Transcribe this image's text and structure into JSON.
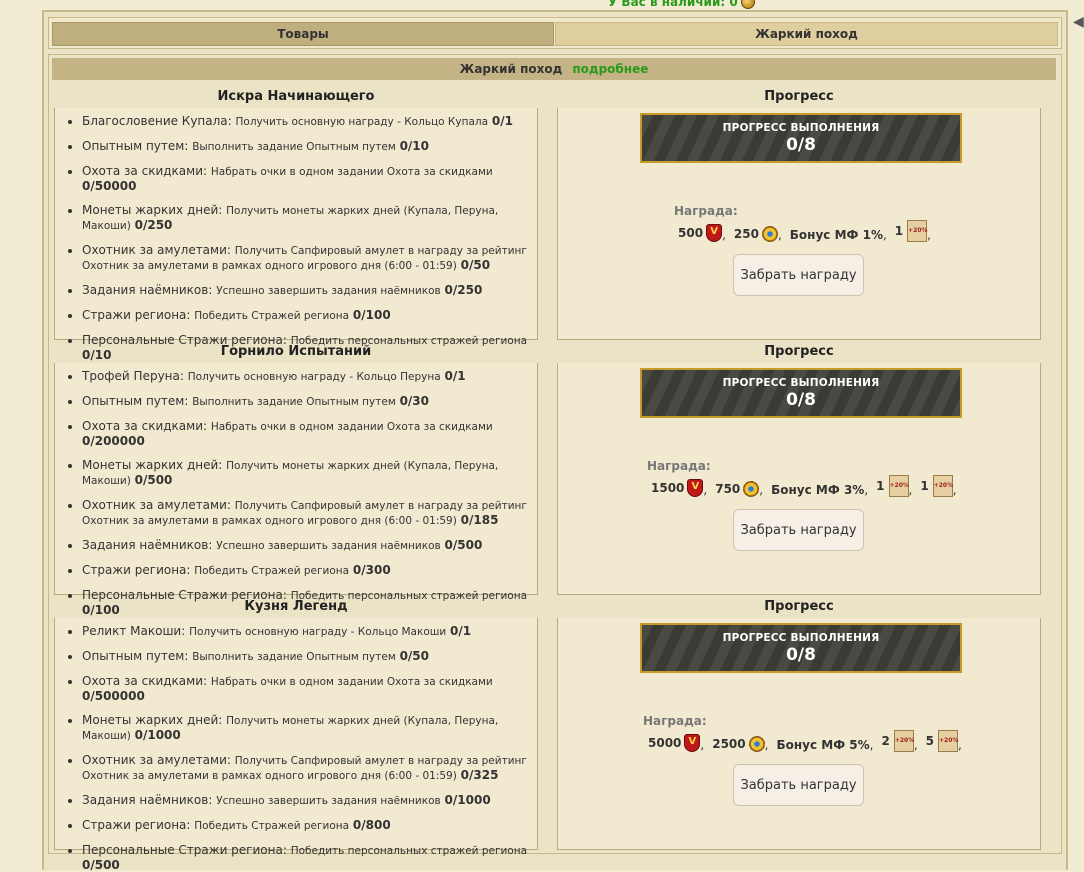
{
  "top": {
    "have_label": "У Вас в наличии: 0"
  },
  "tabs": {
    "goods": "Товары",
    "hot": "Жаркий поход"
  },
  "section": {
    "title": "Жаркий поход",
    "more": "подробнее"
  },
  "progress_title": "Прогресс",
  "progress_bar_label": "ПРОГРЕСС ВЫПОЛНЕНИЯ",
  "reward_label": "Награда:",
  "claim_label": "Забрать награду",
  "tiers": [
    {
      "title": "Искра Начинающего",
      "progress": "0/8",
      "tasks": [
        {
          "name": "Благословение Купала:",
          "desc": "Получить основную награду - Кольцо Купала",
          "val": "0/1"
        },
        {
          "name": "Опытным путем:",
          "desc": "Выполнить задание Опытным путем",
          "val": "0/10"
        },
        {
          "name": "Охота за скидками:",
          "desc": "Набрать очки в одном задании Охота за скидками",
          "val": "0/50000"
        },
        {
          "name": "Монеты жарких дней:",
          "desc": "Получить монеты жарких дней (Купала, Перуна, Макоши)",
          "val": "0/250"
        },
        {
          "name": "Охотник за амулетами:",
          "desc": "Получить Сапфировый амулет в награду за рейтинг Охотник за амулетами в рамках одного игрового дня (6:00 - 01:59)",
          "val": "0/50"
        },
        {
          "name": "Задания наёмников:",
          "desc": "Успешно завершить задания наёмников",
          "val": "0/250"
        },
        {
          "name": "Стражи региона:",
          "desc": "Победить Стражей региона",
          "val": "0/100"
        },
        {
          "name": "Персональные Стражи региона:",
          "desc": "Победить персональных стражей региона",
          "val": "0/10"
        }
      ],
      "reward": {
        "shield": "500",
        "sun": "250",
        "bonus": "Бонус МФ 1%",
        "scrolls": [
          "1"
        ]
      }
    },
    {
      "title": "Горнило Испытаний",
      "progress": "0/8",
      "tasks": [
        {
          "name": "Трофей Перуна:",
          "desc": "Получить основную награду - Кольцо Перуна",
          "val": "0/1"
        },
        {
          "name": "Опытным путем:",
          "desc": "Выполнить задание Опытным путем",
          "val": "0/30"
        },
        {
          "name": "Охота за скидками:",
          "desc": "Набрать очки в одном задании Охота за скидками",
          "val": "0/200000"
        },
        {
          "name": "Монеты жарких дней:",
          "desc": "Получить монеты жарких дней (Купала, Перуна, Макоши)",
          "val": "0/500"
        },
        {
          "name": "Охотник за амулетами:",
          "desc": "Получить Сапфировый амулет в награду за рейтинг Охотник за амулетами в рамках одного игрового дня (6:00 - 01:59)",
          "val": "0/185"
        },
        {
          "name": "Задания наёмников:",
          "desc": "Успешно завершить задания наёмников",
          "val": "0/500"
        },
        {
          "name": "Стражи региона:",
          "desc": "Победить Стражей региона",
          "val": "0/300"
        },
        {
          "name": "Персональные Стражи региона:",
          "desc": "Победить персональных стражей региона",
          "val": "0/100"
        }
      ],
      "reward": {
        "shield": "1500",
        "sun": "750",
        "bonus": "Бонус МФ 3%",
        "scrolls": [
          "1",
          "1"
        ]
      }
    },
    {
      "title": "Кузня Легенд",
      "progress": "0/8",
      "tasks": [
        {
          "name": "Реликт Макоши:",
          "desc": "Получить основную награду - Кольцо Макоши",
          "val": "0/1"
        },
        {
          "name": "Опытным путем:",
          "desc": "Выполнить задание Опытным путем",
          "val": "0/50"
        },
        {
          "name": "Охота за скидками:",
          "desc": "Набрать очки в одном задании Охота за скидками",
          "val": "0/500000"
        },
        {
          "name": "Монеты жарких дней:",
          "desc": "Получить монеты жарких дней (Купала, Перуна, Макоши)",
          "val": "0/1000"
        },
        {
          "name": "Охотник за амулетами:",
          "desc": "Получить Сапфировый амулет в награду за рейтинг Охотник за амулетами в рамках одного игрового дня (6:00 - 01:59)",
          "val": "0/325"
        },
        {
          "name": "Задания наёмников:",
          "desc": "Успешно завершить задания наёмников",
          "val": "0/1000"
        },
        {
          "name": "Стражи региона:",
          "desc": "Победить Стражей региона",
          "val": "0/800"
        },
        {
          "name": "Персональные Стражи региона:",
          "desc": "Победить персональных стражей региона",
          "val": "0/500"
        }
      ],
      "reward": {
        "shield": "5000",
        "sun": "2500",
        "bonus": "Бонус МФ 5%",
        "scrolls": [
          "2",
          "5"
        ]
      }
    }
  ],
  "icons": {
    "shield_glyph": "V",
    "scroll_glyph": "+20%"
  }
}
